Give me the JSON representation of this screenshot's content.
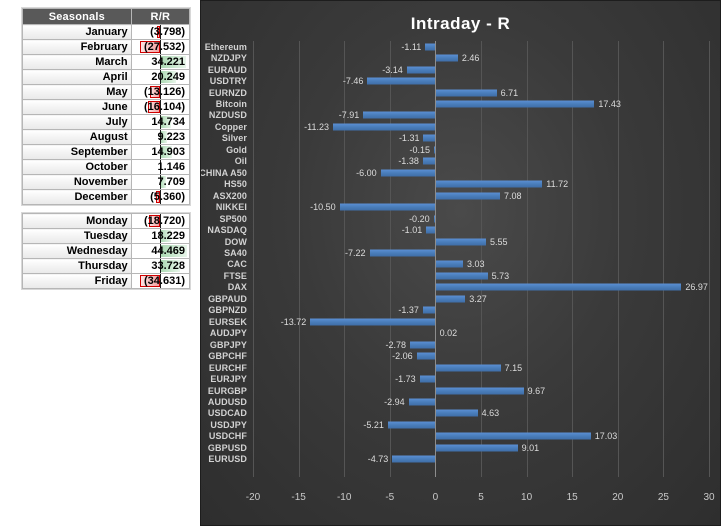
{
  "seasonals_table": {
    "headers": [
      "Seasonals",
      "R/R"
    ],
    "rows": [
      {
        "label": "January",
        "value": "(3.798)",
        "num": -3.798
      },
      {
        "label": "February",
        "value": "(27.532)",
        "num": -27.532
      },
      {
        "label": "March",
        "value": "34.221",
        "num": 34.221
      },
      {
        "label": "April",
        "value": "20.249",
        "num": 20.249
      },
      {
        "label": "May",
        "value": "(13.126)",
        "num": -13.126
      },
      {
        "label": "June",
        "value": "(16.104)",
        "num": -16.104
      },
      {
        "label": "July",
        "value": "14.734",
        "num": 14.734
      },
      {
        "label": "August",
        "value": "9.223",
        "num": 9.223
      },
      {
        "label": "September",
        "value": "14.903",
        "num": 14.903
      },
      {
        "label": "October",
        "value": "1.146",
        "num": 1.146
      },
      {
        "label": "November",
        "value": "7.709",
        "num": 7.709
      },
      {
        "label": "December",
        "value": "(5.360)",
        "num": -5.36
      }
    ]
  },
  "weekdays_table": {
    "rows": [
      {
        "label": "Monday",
        "value": "(18.720)",
        "num": -18.72
      },
      {
        "label": "Tuesday",
        "value": "18.229",
        "num": 18.229
      },
      {
        "label": "Wednesday",
        "value": "44.469",
        "num": 44.469
      },
      {
        "label": "Thursday",
        "value": "33.728",
        "num": 33.728
      },
      {
        "label": "Friday",
        "value": "(34.631)",
        "num": -34.631
      }
    ]
  },
  "chart_data": {
    "type": "bar",
    "orientation": "horizontal",
    "title": "Intraday - R",
    "xlabel": "",
    "ylabel": "",
    "xlim": [
      -20,
      30
    ],
    "xticks": [
      -20,
      -15,
      -10,
      -5,
      0,
      5,
      10,
      15,
      20,
      25,
      30
    ],
    "grid": true,
    "legend": false,
    "bar_color": "#4a7ebb",
    "categories": [
      "Ethereum",
      "NZDJPY",
      "EURAUD",
      "USDTRY",
      "EURNZD",
      "Bitcoin",
      "NZDUSD",
      "Copper",
      "Silver",
      "Gold",
      "Oil",
      "CHINA A50",
      "HS50",
      "ASX200",
      "NIKKEI",
      "SP500",
      "NASDAQ",
      "DOW",
      "SA40",
      "CAC",
      "FTSE",
      "DAX",
      "GBPAUD",
      "GBPNZD",
      "EURSEK",
      "AUDJPY",
      "GBPJPY",
      "GBPCHF",
      "EURCHF",
      "EURJPY",
      "EURGBP",
      "AUDUSD",
      "USDCAD",
      "USDJPY",
      "USDCHF",
      "GBPUSD",
      "EURUSD"
    ],
    "values": [
      -1.11,
      2.46,
      -3.14,
      -7.46,
      6.71,
      17.43,
      -7.91,
      -11.23,
      -1.31,
      -0.15,
      -1.38,
      -6.0,
      11.72,
      7.08,
      -10.5,
      -0.2,
      -1.01,
      5.55,
      -7.22,
      3.03,
      5.73,
      26.97,
      3.27,
      -1.37,
      -13.72,
      0.02,
      -2.78,
      -2.06,
      7.15,
      -1.73,
      9.67,
      -2.94,
      4.63,
      -5.21,
      17.03,
      9.01,
      -4.73
    ],
    "labels": [
      "-1.11",
      "2.46",
      "-3.14",
      "-7.46",
      "6.71",
      "17.43",
      "-7.91",
      "-11.23",
      "-1.31",
      "-0.15",
      "-1.38",
      "-6.00",
      "11.72",
      "7.08",
      "-10.50",
      "-0.20",
      "-1.01",
      "5.55",
      "-7.22",
      "3.03",
      "5.73",
      "26.97",
      "3.27",
      "-1.37",
      "-13.72",
      "0.02",
      "-2.78",
      "-2.06",
      "7.15",
      "-1.73",
      "9.67",
      "-2.94",
      "4.63",
      "-5.21",
      "17.03",
      "9.01",
      "-4.73"
    ]
  }
}
